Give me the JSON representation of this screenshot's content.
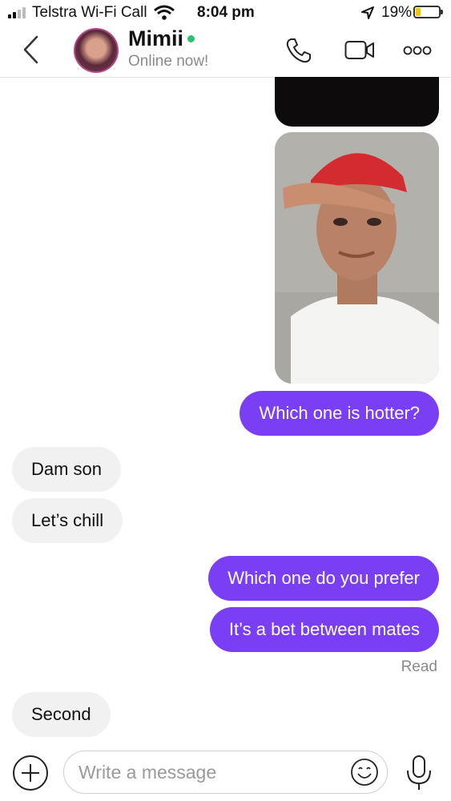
{
  "status_bar": {
    "carrier": "Telstra Wi-Fi Call",
    "time": "8:04 pm",
    "battery_percent": "19%",
    "battery_level": 0.19,
    "icons": [
      "signal-icon",
      "wifi-icon",
      "location-arrow-icon",
      "battery-icon"
    ]
  },
  "header": {
    "contact_name": "Mimii",
    "presence": "Online now!",
    "presence_color": "#29c56a",
    "icons": [
      "back-chevron-icon",
      "phone-icon",
      "video-icon",
      "more-icon"
    ]
  },
  "messages": [
    {
      "type": "image",
      "direction": "outgoing",
      "description_name": "dark-photo"
    },
    {
      "type": "image",
      "direction": "outgoing",
      "description_name": "selfie-photo"
    },
    {
      "type": "text",
      "direction": "outgoing",
      "text": "Which one is hotter?"
    },
    {
      "type": "text",
      "direction": "incoming",
      "text": "Dam son"
    },
    {
      "type": "text",
      "direction": "incoming",
      "text": "Let’s chill"
    },
    {
      "type": "text",
      "direction": "outgoing",
      "text": "Which one do you prefer"
    },
    {
      "type": "text",
      "direction": "outgoing",
      "text": "It’s a bet between mates"
    },
    {
      "type": "text",
      "direction": "incoming",
      "text": "Second"
    }
  ],
  "read_receipt": "Read",
  "composer": {
    "placeholder": "Write a message",
    "value": ""
  },
  "colors": {
    "outgoing_bubble": "#7a3ef5",
    "incoming_bubble": "#f1f1f1"
  }
}
